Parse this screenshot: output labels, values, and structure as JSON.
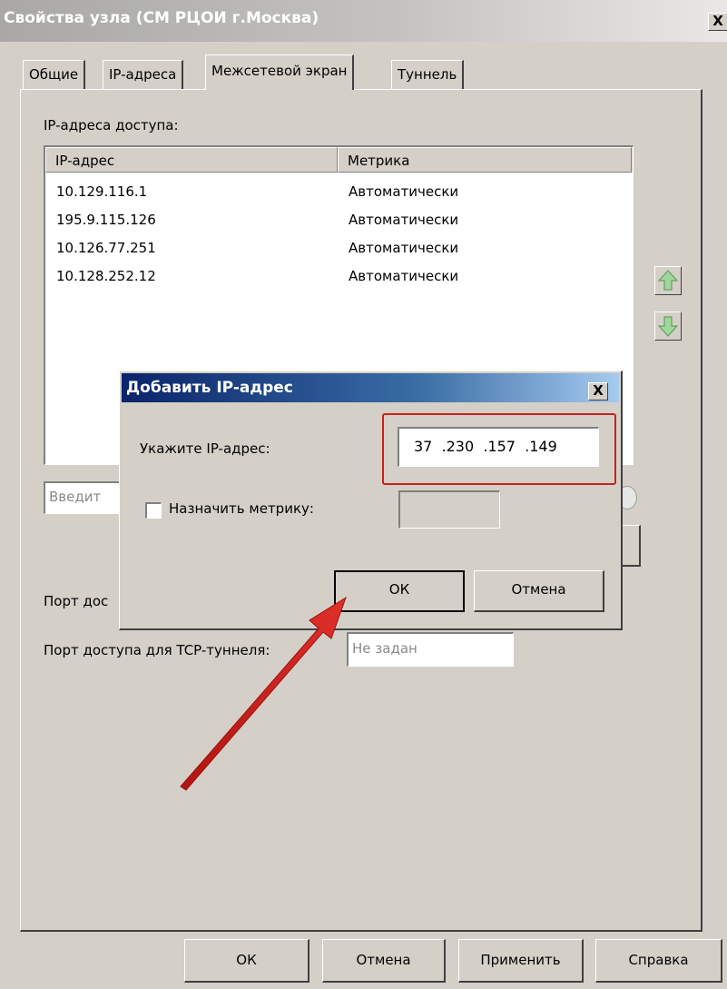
{
  "window": {
    "title": "Свойства узла (СМ РЦОИ г.Москва)",
    "close_glyph": "X"
  },
  "tabs": [
    {
      "label": "Общие",
      "active": false
    },
    {
      "label": "IP-адреса",
      "active": false
    },
    {
      "label": "Межсетевой экран",
      "active": true
    },
    {
      "label": "Туннель",
      "active": false
    }
  ],
  "firewall": {
    "access_label": "IP-адреса доступа:",
    "columns": [
      "IP-адрес",
      "Метрика"
    ],
    "rows": [
      {
        "ip": "10.129.116.1",
        "metric": "Автоматически"
      },
      {
        "ip": "195.9.115.126",
        "metric": "Автоматически"
      },
      {
        "ip": "10.126.77.251",
        "metric": "Автоматически"
      },
      {
        "ip": "10.128.252.12",
        "metric": "Автоматически"
      }
    ],
    "input_placeholder": "Введит",
    "port_label_partial": "Порт дос",
    "tcp_port_label": "Порт доступа для TCP-туннеля:",
    "tcp_port_value": "Не задан"
  },
  "dialog": {
    "title": "Добавить IP-адрес",
    "close_glyph": "X",
    "ip_label": "Укажите IP-адрес:",
    "ip_value": "37  .230  .157  .149",
    "metric_label": "Назначить метрику:",
    "metric_checked": false,
    "ok_label": "ОК",
    "cancel_label": "Отмена"
  },
  "footer": {
    "ok_label": "ОК",
    "cancel_label": "Отмена",
    "apply_label": "Применить",
    "help_label": "Справка"
  },
  "colors": {
    "highlight_box": "#c8201e",
    "arrow": "#c8201e",
    "dialog_title": "#0a246a",
    "window_bg": "#d4d0c8"
  }
}
